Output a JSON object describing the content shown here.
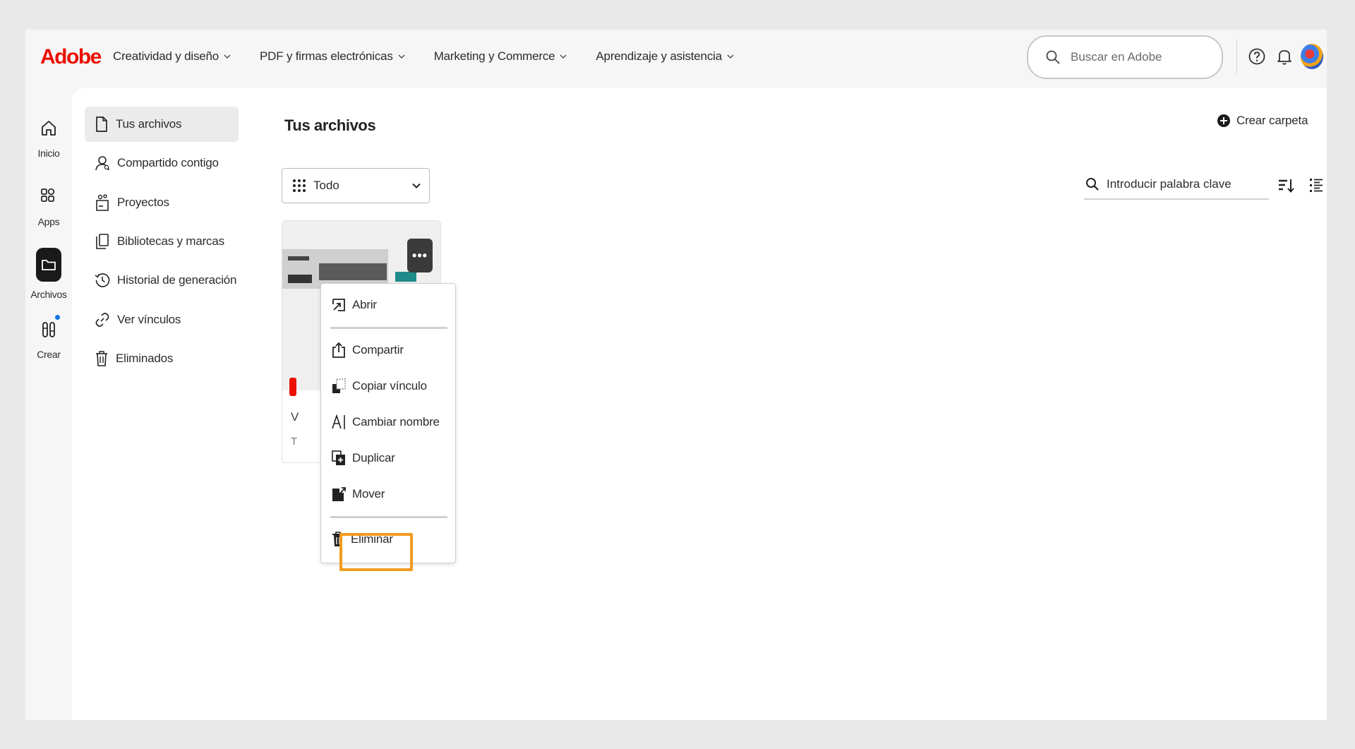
{
  "header": {
    "logo": "Adobe",
    "nav": [
      {
        "label": "Creatividad y diseño"
      },
      {
        "label": "PDF y firmas electrónicas"
      },
      {
        "label": "Marketing y Commerce"
      },
      {
        "label": "Aprendizaje y asistencia"
      }
    ],
    "search_placeholder": "Buscar en Adobe"
  },
  "rail": [
    {
      "label": "Inicio",
      "icon": "home-icon"
    },
    {
      "label": "Apps",
      "icon": "apps-icon"
    },
    {
      "label": "Archivos",
      "icon": "folder-icon",
      "active": true
    },
    {
      "label": "Crear",
      "icon": "create-icon"
    }
  ],
  "sidebar": [
    {
      "label": "Tus archivos",
      "icon": "file-icon",
      "active": true
    },
    {
      "label": "Compartido contigo",
      "icon": "shared-user-icon"
    },
    {
      "label": "Proyectos",
      "icon": "projects-icon"
    },
    {
      "label": "Bibliotecas y marcas",
      "icon": "libraries-icon"
    },
    {
      "label": "Historial de generación",
      "icon": "history-icon"
    },
    {
      "label": "Ver vínculos",
      "icon": "link-icon"
    },
    {
      "label": "Eliminados",
      "icon": "trash-icon"
    }
  ],
  "main": {
    "title": "Tus archivos",
    "create_folder": "Crear carpeta",
    "filter_value": "Todo",
    "keyword_placeholder": "Introducir palabra clave"
  },
  "card": {
    "name_fragment": "V",
    "type_fragment": "T"
  },
  "context_menu": [
    {
      "label": "Abrir",
      "icon": "open-icon"
    },
    {
      "label": "Compartir",
      "icon": "share-icon"
    },
    {
      "label": "Copiar vínculo",
      "icon": "copy-link-icon"
    },
    {
      "label": "Cambiar nombre",
      "icon": "rename-icon"
    },
    {
      "label": "Duplicar",
      "icon": "duplicate-icon"
    },
    {
      "label": "Mover",
      "icon": "move-icon",
      "highlighted": true
    },
    {
      "label": "Eliminar",
      "icon": "delete-icon"
    }
  ],
  "colors": {
    "brand": "#eb1000",
    "highlight": "#f39a21",
    "notification_dot": "#1473e6"
  }
}
